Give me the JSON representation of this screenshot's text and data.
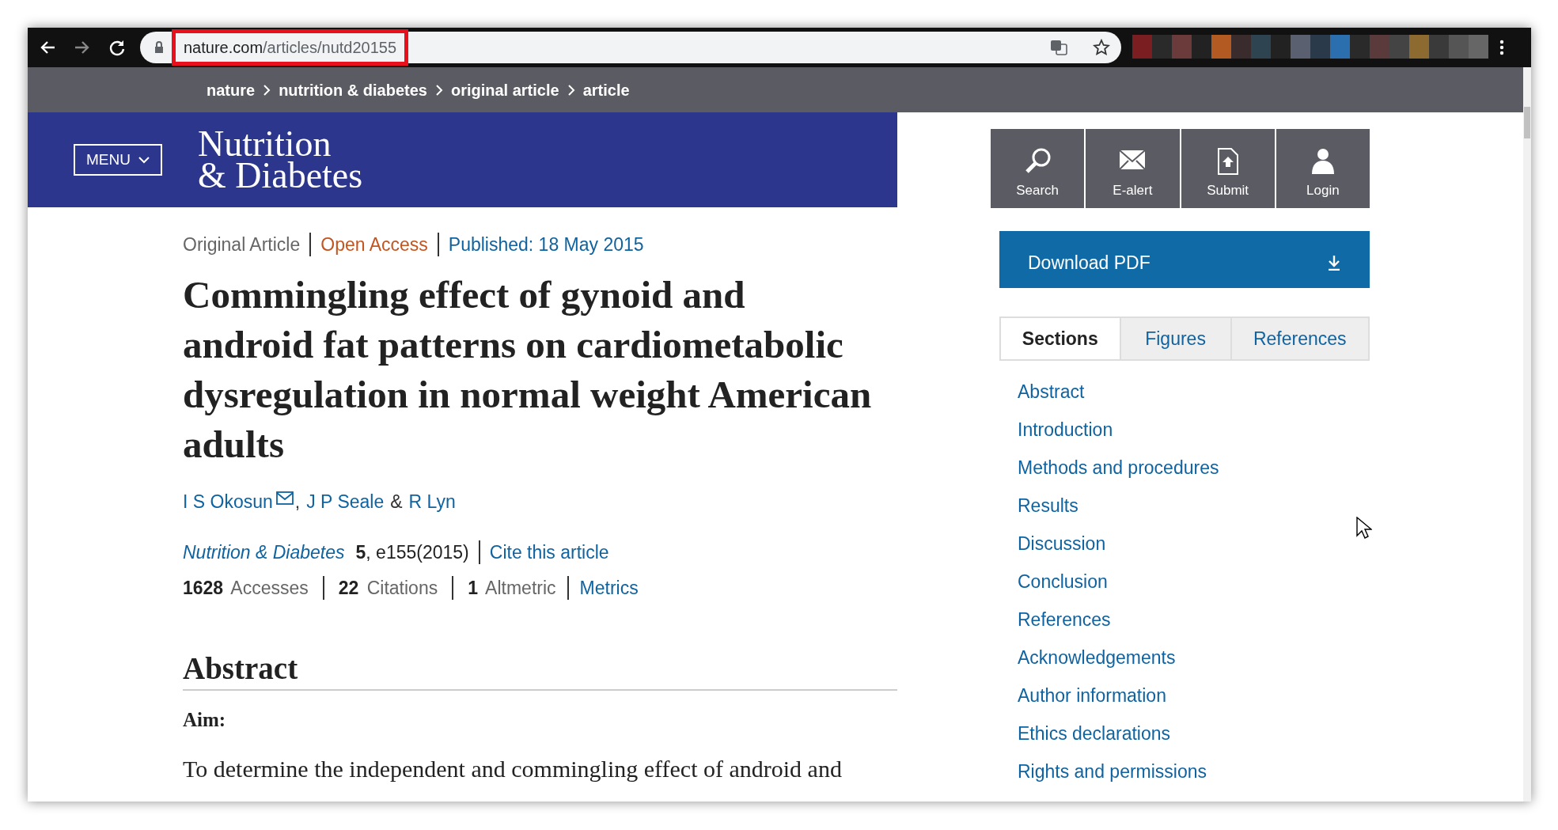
{
  "browser": {
    "url_host": "nature.com",
    "url_path": "/articles/nutd20155",
    "highlighted": true
  },
  "breadcrumb": [
    "nature",
    "nutrition & diabetes",
    "original article",
    "article"
  ],
  "header": {
    "menu": "MENU",
    "logo_lines": [
      "Nutrition",
      "& Diabetes"
    ]
  },
  "article": {
    "type": "Original Article",
    "access": "Open Access",
    "published": "Published: 18 May 2015",
    "title": "Commingling effect of gynoid and android fat patterns on cardiometabolic dysregulation in normal weight American adults",
    "authors": [
      {
        "name": "I S Okosun",
        "email": true,
        "after": ","
      },
      {
        "name": "J P Seale",
        "email": false,
        "after": "&"
      },
      {
        "name": "R Lyn",
        "email": false
      }
    ],
    "journal": "Nutrition & Diabetes",
    "volume": "5",
    "pages": ", e155(2015)",
    "cite": "Cite this article",
    "metrics": [
      "**1628** Accesses",
      "**22** Citations",
      "**1** Altmetric"
    ],
    "metrics_link": "Metrics"
  },
  "abstract": {
    "heading": "Abstract",
    "subheading": "Aim:",
    "text": "To determine the independent and commingling effect of android and"
  },
  "tools": [
    {
      "kind": "search",
      "label": "Search"
    },
    {
      "kind": "mail",
      "label": "E-alert"
    },
    {
      "kind": "submit",
      "label": "Submit"
    },
    {
      "kind": "login",
      "label": "Login"
    }
  ],
  "download": "Download PDF",
  "tabs": [
    {
      "label": "Sections",
      "selected": true
    },
    {
      "label": "Figures",
      "selected": false
    },
    {
      "label": "References",
      "selected": false
    }
  ],
  "sections": [
    "Abstract",
    "Introduction",
    "Methods and procedures",
    "Results",
    "Discussion",
    "Conclusion",
    "References",
    "Acknowledgements",
    "Author information",
    "Ethics declarations",
    "Rights and permissions"
  ]
}
